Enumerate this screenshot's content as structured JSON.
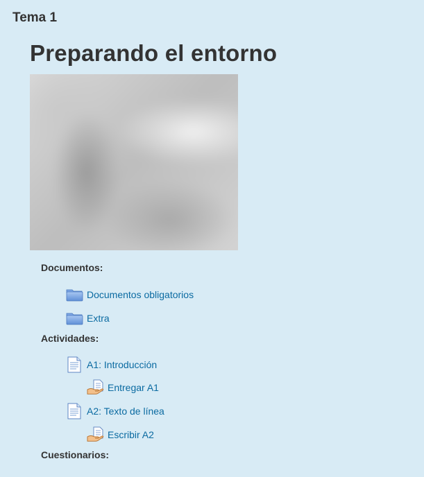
{
  "section": {
    "name": "Tema 1"
  },
  "summary": {
    "title": "Preparando el entorno"
  },
  "labels": {
    "documents": "Documentos:",
    "activities": "Actividades:",
    "quizzes": "Cuestionarios:"
  },
  "documents": [
    {
      "label": "Documentos obligatorios",
      "icon": "folder-icon"
    },
    {
      "label": "Extra",
      "icon": "folder-icon"
    }
  ],
  "activities": [
    {
      "label": "A1: Introducción",
      "icon": "page-icon"
    },
    {
      "label": "Entregar A1",
      "icon": "assignment-icon"
    },
    {
      "label": "A2: Texto de línea",
      "icon": "page-icon"
    },
    {
      "label": "Escribir A2",
      "icon": "assignment-icon"
    }
  ]
}
